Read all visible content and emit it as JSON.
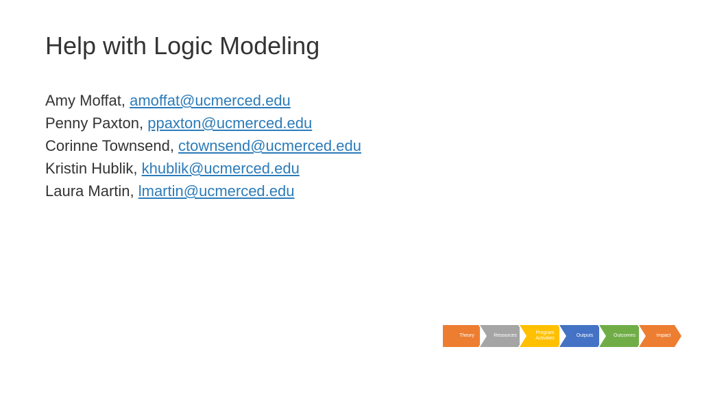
{
  "title": "Help with Logic Modeling",
  "contacts": [
    {
      "name": "Amy Moffat, ",
      "email": "amoffat@ucmerced.edu"
    },
    {
      "name": "Penny Paxton, ",
      "email": "ppaxton@ucmerced.edu"
    },
    {
      "name": "Corinne Townsend, ",
      "email": "ctownsend@ucmerced.edu"
    },
    {
      "name": "Kristin Hublik, ",
      "email": "khublik@ucmerced.edu"
    },
    {
      "name": "Laura Martin, ",
      "email": "lmartin@ucmerced.edu"
    }
  ],
  "arrows": [
    {
      "label": "Theory"
    },
    {
      "label": "Resources"
    },
    {
      "label": "Program\nActivities"
    },
    {
      "label": "Outputs"
    },
    {
      "label": "Outcomes"
    },
    {
      "label": "Impact"
    }
  ]
}
